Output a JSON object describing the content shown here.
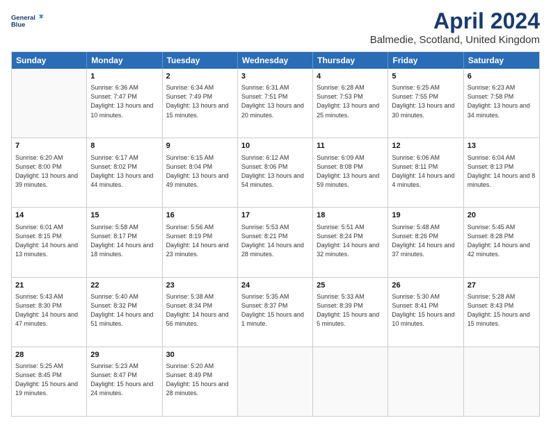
{
  "logo": {
    "line1": "General",
    "line2": "Blue"
  },
  "title": "April 2024",
  "subtitle": "Balmedie, Scotland, United Kingdom",
  "days_of_week": [
    "Sunday",
    "Monday",
    "Tuesday",
    "Wednesday",
    "Thursday",
    "Friday",
    "Saturday"
  ],
  "weeks": [
    [
      {
        "day": "",
        "sunrise": "",
        "sunset": "",
        "daylight": ""
      },
      {
        "day": "1",
        "sunrise": "Sunrise: 6:36 AM",
        "sunset": "Sunset: 7:47 PM",
        "daylight": "Daylight: 13 hours and 10 minutes."
      },
      {
        "day": "2",
        "sunrise": "Sunrise: 6:34 AM",
        "sunset": "Sunset: 7:49 PM",
        "daylight": "Daylight: 13 hours and 15 minutes."
      },
      {
        "day": "3",
        "sunrise": "Sunrise: 6:31 AM",
        "sunset": "Sunset: 7:51 PM",
        "daylight": "Daylight: 13 hours and 20 minutes."
      },
      {
        "day": "4",
        "sunrise": "Sunrise: 6:28 AM",
        "sunset": "Sunset: 7:53 PM",
        "daylight": "Daylight: 13 hours and 25 minutes."
      },
      {
        "day": "5",
        "sunrise": "Sunrise: 6:25 AM",
        "sunset": "Sunset: 7:55 PM",
        "daylight": "Daylight: 13 hours and 30 minutes."
      },
      {
        "day": "6",
        "sunrise": "Sunrise: 6:23 AM",
        "sunset": "Sunset: 7:58 PM",
        "daylight": "Daylight: 13 hours and 34 minutes."
      }
    ],
    [
      {
        "day": "7",
        "sunrise": "Sunrise: 6:20 AM",
        "sunset": "Sunset: 8:00 PM",
        "daylight": "Daylight: 13 hours and 39 minutes."
      },
      {
        "day": "8",
        "sunrise": "Sunrise: 6:17 AM",
        "sunset": "Sunset: 8:02 PM",
        "daylight": "Daylight: 13 hours and 44 minutes."
      },
      {
        "day": "9",
        "sunrise": "Sunrise: 6:15 AM",
        "sunset": "Sunset: 8:04 PM",
        "daylight": "Daylight: 13 hours and 49 minutes."
      },
      {
        "day": "10",
        "sunrise": "Sunrise: 6:12 AM",
        "sunset": "Sunset: 8:06 PM",
        "daylight": "Daylight: 13 hours and 54 minutes."
      },
      {
        "day": "11",
        "sunrise": "Sunrise: 6:09 AM",
        "sunset": "Sunset: 8:08 PM",
        "daylight": "Daylight: 13 hours and 59 minutes."
      },
      {
        "day": "12",
        "sunrise": "Sunrise: 6:06 AM",
        "sunset": "Sunset: 8:11 PM",
        "daylight": "Daylight: 14 hours and 4 minutes."
      },
      {
        "day": "13",
        "sunrise": "Sunrise: 6:04 AM",
        "sunset": "Sunset: 8:13 PM",
        "daylight": "Daylight: 14 hours and 8 minutes."
      }
    ],
    [
      {
        "day": "14",
        "sunrise": "Sunrise: 6:01 AM",
        "sunset": "Sunset: 8:15 PM",
        "daylight": "Daylight: 14 hours and 13 minutes."
      },
      {
        "day": "15",
        "sunrise": "Sunrise: 5:58 AM",
        "sunset": "Sunset: 8:17 PM",
        "daylight": "Daylight: 14 hours and 18 minutes."
      },
      {
        "day": "16",
        "sunrise": "Sunrise: 5:56 AM",
        "sunset": "Sunset: 8:19 PM",
        "daylight": "Daylight: 14 hours and 23 minutes."
      },
      {
        "day": "17",
        "sunrise": "Sunrise: 5:53 AM",
        "sunset": "Sunset: 8:21 PM",
        "daylight": "Daylight: 14 hours and 28 minutes."
      },
      {
        "day": "18",
        "sunrise": "Sunrise: 5:51 AM",
        "sunset": "Sunset: 8:24 PM",
        "daylight": "Daylight: 14 hours and 32 minutes."
      },
      {
        "day": "19",
        "sunrise": "Sunrise: 5:48 AM",
        "sunset": "Sunset: 8:26 PM",
        "daylight": "Daylight: 14 hours and 37 minutes."
      },
      {
        "day": "20",
        "sunrise": "Sunrise: 5:45 AM",
        "sunset": "Sunset: 8:28 PM",
        "daylight": "Daylight: 14 hours and 42 minutes."
      }
    ],
    [
      {
        "day": "21",
        "sunrise": "Sunrise: 5:43 AM",
        "sunset": "Sunset: 8:30 PM",
        "daylight": "Daylight: 14 hours and 47 minutes."
      },
      {
        "day": "22",
        "sunrise": "Sunrise: 5:40 AM",
        "sunset": "Sunset: 8:32 PM",
        "daylight": "Daylight: 14 hours and 51 minutes."
      },
      {
        "day": "23",
        "sunrise": "Sunrise: 5:38 AM",
        "sunset": "Sunset: 8:34 PM",
        "daylight": "Daylight: 14 hours and 56 minutes."
      },
      {
        "day": "24",
        "sunrise": "Sunrise: 5:35 AM",
        "sunset": "Sunset: 8:37 PM",
        "daylight": "Daylight: 15 hours and 1 minute."
      },
      {
        "day": "25",
        "sunrise": "Sunrise: 5:33 AM",
        "sunset": "Sunset: 8:39 PM",
        "daylight": "Daylight: 15 hours and 5 minutes."
      },
      {
        "day": "26",
        "sunrise": "Sunrise: 5:30 AM",
        "sunset": "Sunset: 8:41 PM",
        "daylight": "Daylight: 15 hours and 10 minutes."
      },
      {
        "day": "27",
        "sunrise": "Sunrise: 5:28 AM",
        "sunset": "Sunset: 8:43 PM",
        "daylight": "Daylight: 15 hours and 15 minutes."
      }
    ],
    [
      {
        "day": "28",
        "sunrise": "Sunrise: 5:25 AM",
        "sunset": "Sunset: 8:45 PM",
        "daylight": "Daylight: 15 hours and 19 minutes."
      },
      {
        "day": "29",
        "sunrise": "Sunrise: 5:23 AM",
        "sunset": "Sunset: 8:47 PM",
        "daylight": "Daylight: 15 hours and 24 minutes."
      },
      {
        "day": "30",
        "sunrise": "Sunrise: 5:20 AM",
        "sunset": "Sunset: 8:49 PM",
        "daylight": "Daylight: 15 hours and 28 minutes."
      },
      {
        "day": "",
        "sunrise": "",
        "sunset": "",
        "daylight": ""
      },
      {
        "day": "",
        "sunrise": "",
        "sunset": "",
        "daylight": ""
      },
      {
        "day": "",
        "sunrise": "",
        "sunset": "",
        "daylight": ""
      },
      {
        "day": "",
        "sunrise": "",
        "sunset": "",
        "daylight": ""
      }
    ]
  ]
}
